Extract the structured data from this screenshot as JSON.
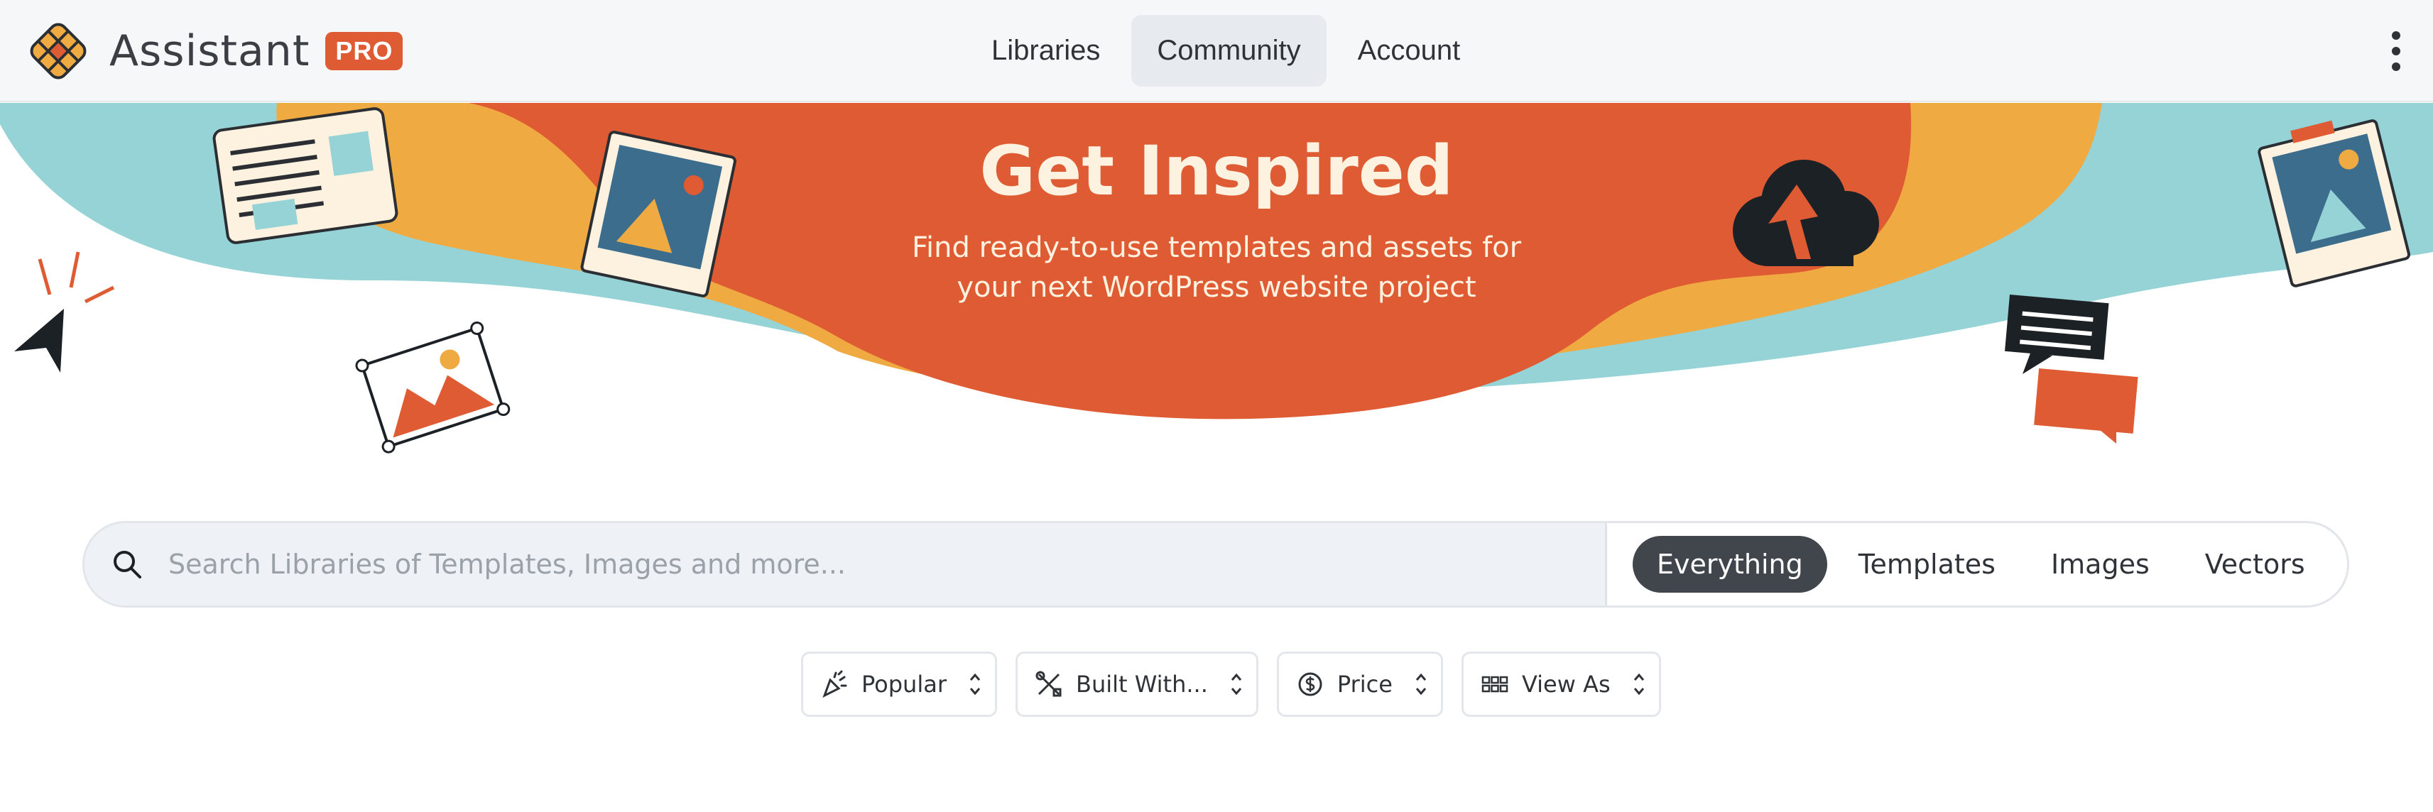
{
  "header": {
    "brand_name": "Assistant",
    "brand_badge": "PRO",
    "nav": [
      {
        "label": "Libraries",
        "active": false
      },
      {
        "label": "Community",
        "active": true
      },
      {
        "label": "Account",
        "active": false
      }
    ],
    "menu_icon": "more-vertical-icon"
  },
  "hero": {
    "title": "Get Inspired",
    "subtitle": "Find ready-to-use templates and assets for your next WordPress website project"
  },
  "search": {
    "placeholder": "Search Libraries of Templates, Images and more...",
    "value": "",
    "icon": "search-icon",
    "tabs": [
      {
        "label": "Everything",
        "active": true
      },
      {
        "label": "Templates",
        "active": false
      },
      {
        "label": "Images",
        "active": false
      },
      {
        "label": "Vectors",
        "active": false
      }
    ]
  },
  "filters": [
    {
      "label": "Popular",
      "icon": "party-popper-icon"
    },
    {
      "label": "Built With...",
      "icon": "tools-icon"
    },
    {
      "label": "Price",
      "icon": "dollar-circle-icon"
    },
    {
      "label": "View As",
      "icon": "grid-icon"
    }
  ],
  "colors": {
    "accent_orange": "#df5b33",
    "yellow": "#f0aa42",
    "teal": "#95d3d6",
    "dark": "#40464c"
  }
}
